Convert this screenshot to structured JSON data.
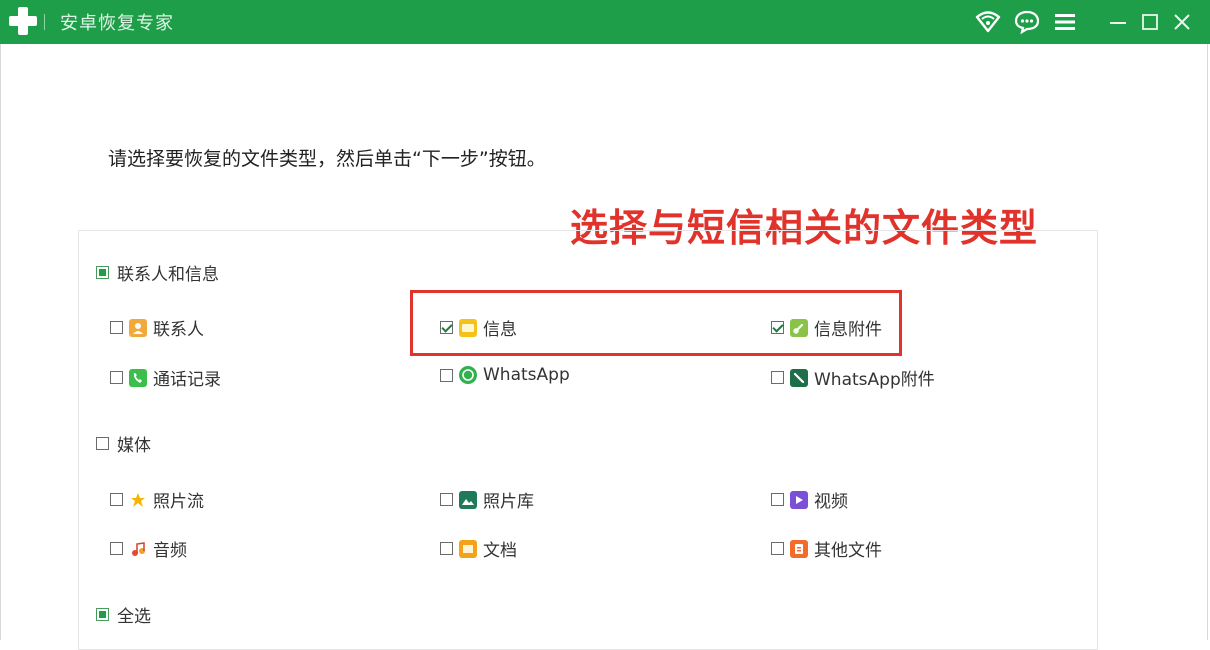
{
  "window": {
    "title": "安卓恢复专家",
    "accent_color": "#1f9e4a",
    "icons": [
      "wifi-heart-icon",
      "chat-icon",
      "menu-icon",
      "minimize-icon",
      "maximize-icon",
      "close-icon"
    ]
  },
  "instruction": "请选择要恢复的文件类型，然后单击“下一步”按钮。",
  "annotation": "选择与短信相关的文件类型",
  "annotation_color": "#e0332c",
  "groups": [
    {
      "label": "联系人和信息",
      "state": "partial",
      "items": [
        {
          "label": "联系人",
          "checked": false,
          "icon": "contacts-icon"
        },
        {
          "label": "信息",
          "checked": true,
          "icon": "messages-icon"
        },
        {
          "label": "信息附件",
          "checked": true,
          "icon": "message-attachment-icon"
        },
        {
          "label": "通话记录",
          "checked": false,
          "icon": "call-log-icon"
        },
        {
          "label": "WhatsApp",
          "checked": false,
          "icon": "whatsapp-icon"
        },
        {
          "label": "WhatsApp附件",
          "checked": false,
          "icon": "whatsapp-attachment-icon"
        }
      ]
    },
    {
      "label": "媒体",
      "state": "unchecked",
      "items": [
        {
          "label": "照片流",
          "checked": false,
          "icon": "photo-stream-icon"
        },
        {
          "label": "照片库",
          "checked": false,
          "icon": "photo-library-icon"
        },
        {
          "label": "视频",
          "checked": false,
          "icon": "video-icon"
        },
        {
          "label": "音频",
          "checked": false,
          "icon": "audio-icon"
        },
        {
          "label": "文档",
          "checked": false,
          "icon": "document-icon"
        },
        {
          "label": "其他文件",
          "checked": false,
          "icon": "other-files-icon"
        }
      ]
    }
  ],
  "select_all": {
    "label": "全选",
    "state": "partial"
  }
}
